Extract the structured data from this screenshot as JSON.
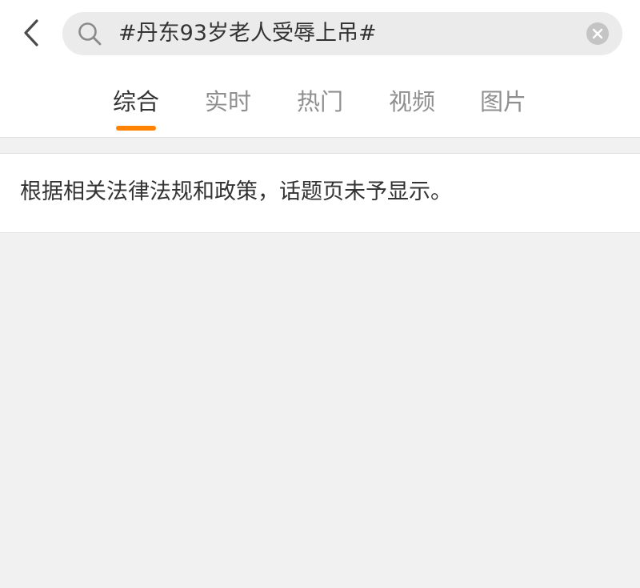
{
  "search": {
    "query": "#丹东93岁老人受辱上吊#"
  },
  "tabs": [
    {
      "label": "综合",
      "active": true
    },
    {
      "label": "实时",
      "active": false
    },
    {
      "label": "热门",
      "active": false
    },
    {
      "label": "视频",
      "active": false
    },
    {
      "label": "图片",
      "active": false
    }
  ],
  "notice": {
    "text": "根据相关法律法规和政策，话题页未予显示。"
  },
  "colors": {
    "accent": "#ff8200",
    "background": "#f1f1f1",
    "search_bg": "#ebebeb"
  },
  "icons": {
    "back": "chevron-left-icon",
    "search": "search-icon",
    "clear": "close-circle-icon"
  }
}
